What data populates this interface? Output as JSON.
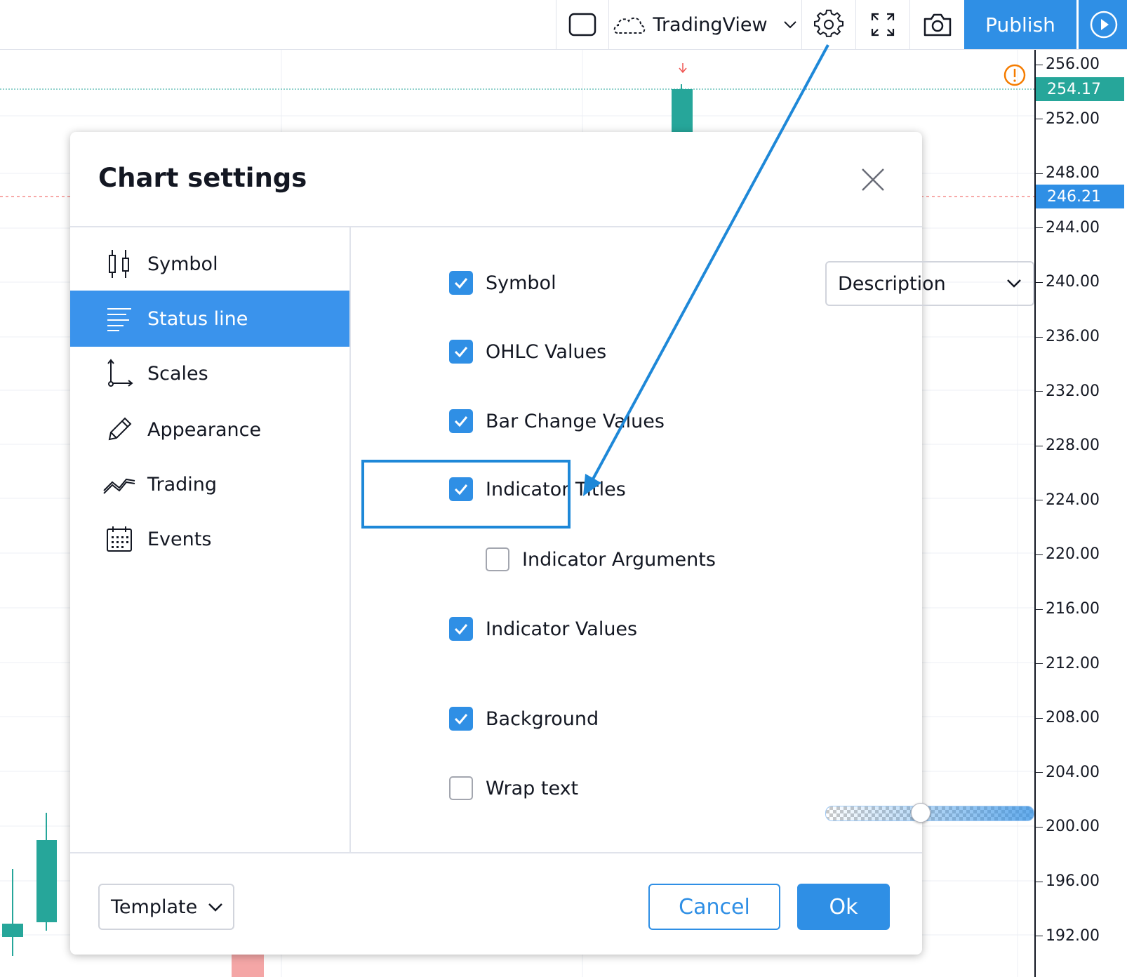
{
  "toolbar": {
    "layout_label": "TradingView",
    "publish_label": "Publish"
  },
  "price_axis": {
    "ticks": [
      "256.00",
      "252.00",
      "248.00",
      "244.00",
      "240.00",
      "236.00",
      "232.00",
      "228.00",
      "224.00",
      "220.00",
      "216.00",
      "212.00",
      "208.00",
      "204.00",
      "200.00",
      "196.00",
      "192.00"
    ],
    "last_price": "254.17",
    "last_price_color": "#26a69a",
    "marker_price": "246.21",
    "marker_price_color": "#2f8fe5"
  },
  "dialog": {
    "title": "Chart settings",
    "sidebar": [
      {
        "label": "Symbol",
        "icon": "candles-icon",
        "active": false
      },
      {
        "label": "Status line",
        "icon": "status-line-icon",
        "active": true
      },
      {
        "label": "Scales",
        "icon": "scales-icon",
        "active": false
      },
      {
        "label": "Appearance",
        "icon": "pencil-icon",
        "active": false
      },
      {
        "label": "Trading",
        "icon": "trading-icon",
        "active": false
      },
      {
        "label": "Events",
        "icon": "calendar-icon",
        "active": false
      }
    ],
    "options": {
      "symbol": {
        "label": "Symbol",
        "checked": true,
        "display": "Description"
      },
      "ohlc": {
        "label": "OHLC Values",
        "checked": true
      },
      "bar_change": {
        "label": "Bar Change Values",
        "checked": true
      },
      "indicator_titles": {
        "label": "Indicator Titles",
        "checked": true
      },
      "indicator_arguments": {
        "label": "Indicator Arguments",
        "checked": false
      },
      "indicator_values": {
        "label": "Indicator Values",
        "checked": true
      },
      "background": {
        "label": "Background",
        "checked": true,
        "opacity": 0.5
      },
      "wrap_text": {
        "label": "Wrap text",
        "checked": false
      }
    },
    "footer": {
      "template_label": "Template",
      "cancel_label": "Cancel",
      "ok_label": "Ok"
    }
  },
  "colors": {
    "accent": "#2f8fe5",
    "up_candle": "#26a69a",
    "down_candle": "#ef9a9a",
    "annotation_arrow": "#1e88d8",
    "warning": "#f57c00"
  }
}
